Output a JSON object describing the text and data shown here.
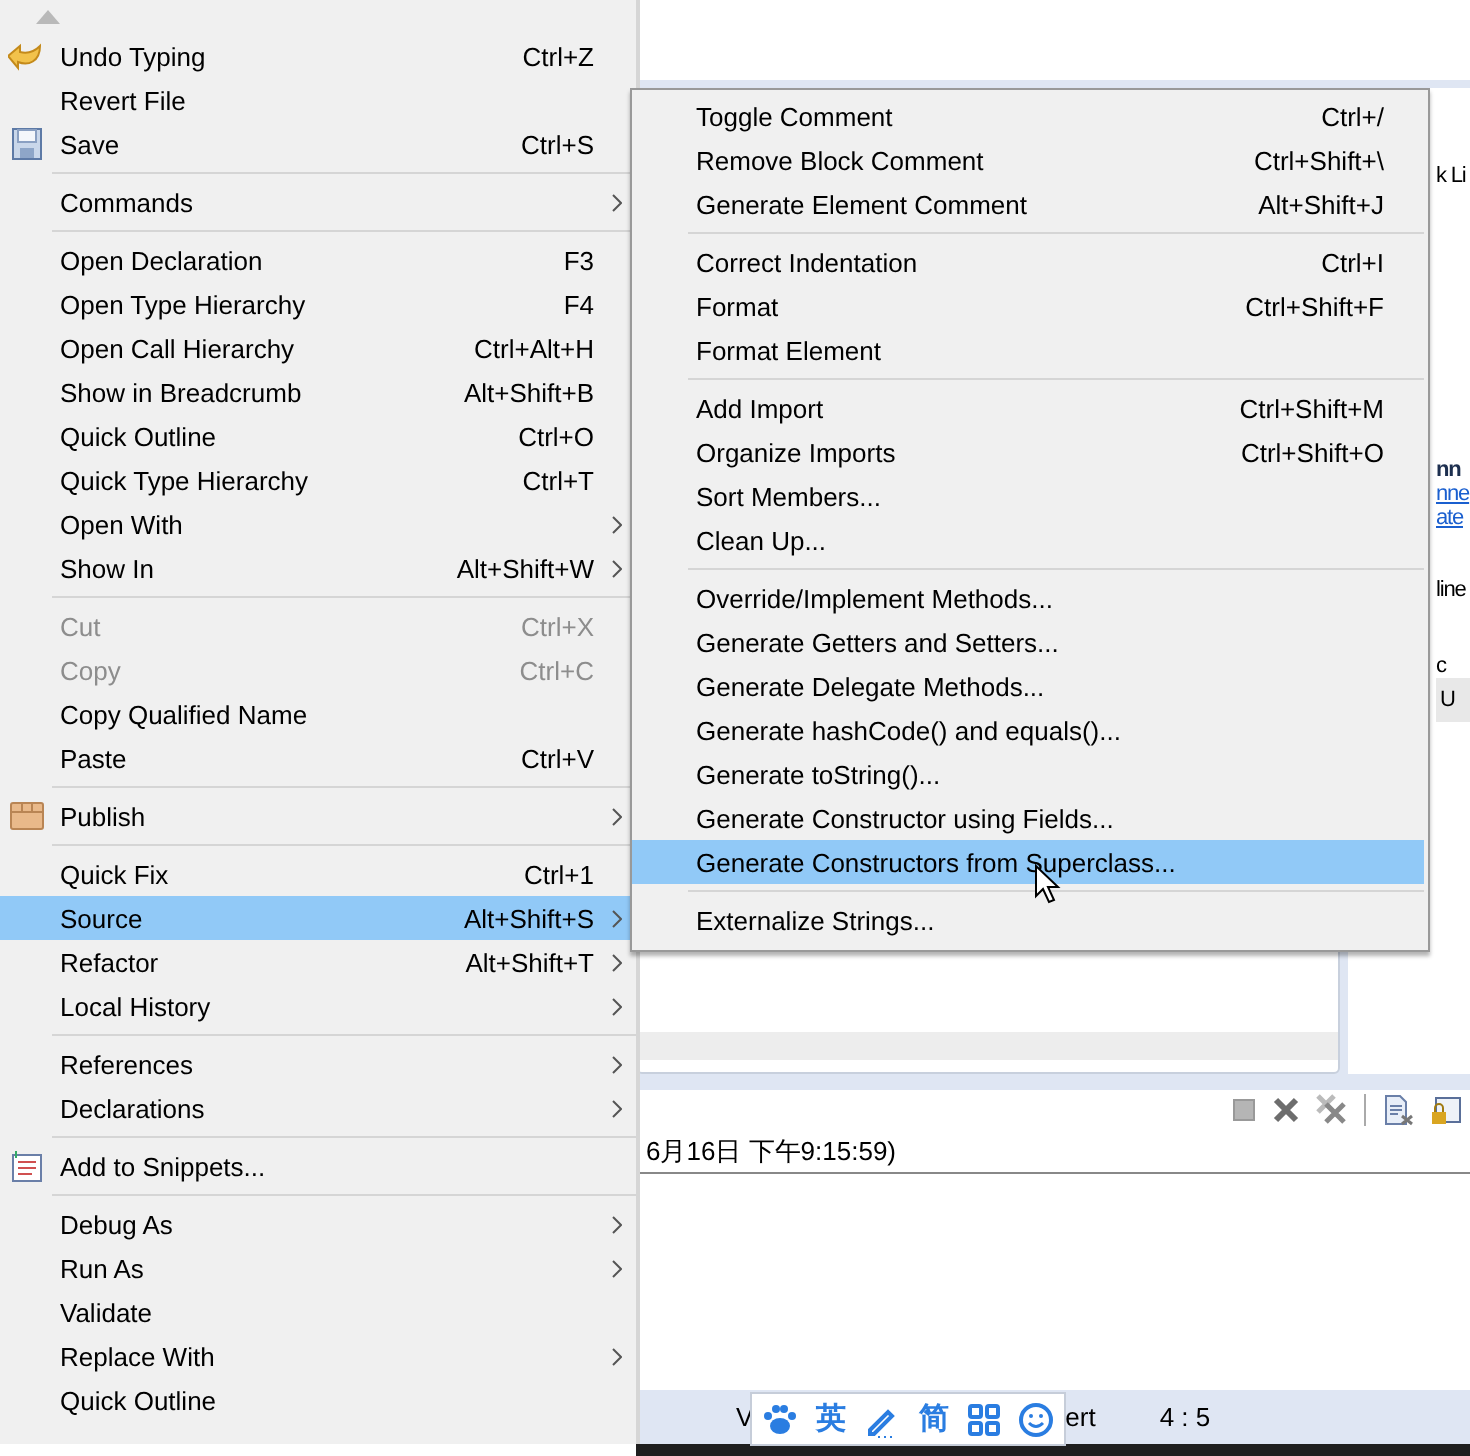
{
  "main_menu": {
    "items": [
      {
        "kind": "undo",
        "label": "Undo Typing",
        "shortcut": "Ctrl+Z",
        "submenu": false,
        "disabled": false,
        "selected": false
      },
      {
        "kind": "item",
        "label": "Revert File",
        "submenu": false,
        "disabled": false,
        "selected": false
      },
      {
        "kind": "save",
        "label": "Save",
        "shortcut": "Ctrl+S",
        "submenu": false,
        "disabled": false,
        "selected": false
      },
      {
        "kind": "separator"
      },
      {
        "kind": "item",
        "label": "Commands",
        "submenu": true,
        "disabled": false,
        "selected": false
      },
      {
        "kind": "separator"
      },
      {
        "kind": "item",
        "label": "Open Declaration",
        "shortcut": "F3",
        "submenu": false,
        "disabled": false,
        "selected": false
      },
      {
        "kind": "item",
        "label": "Open Type Hierarchy",
        "shortcut": "F4",
        "submenu": false,
        "disabled": false,
        "selected": false
      },
      {
        "kind": "item",
        "label": "Open Call Hierarchy",
        "shortcut": "Ctrl+Alt+H",
        "submenu": false,
        "disabled": false,
        "selected": false
      },
      {
        "kind": "item",
        "label": "Show in Breadcrumb",
        "shortcut": "Alt+Shift+B",
        "submenu": false,
        "disabled": false,
        "selected": false
      },
      {
        "kind": "item",
        "label": "Quick Outline",
        "shortcut": "Ctrl+O",
        "submenu": false,
        "disabled": false,
        "selected": false
      },
      {
        "kind": "item",
        "label": "Quick Type Hierarchy",
        "shortcut": "Ctrl+T",
        "submenu": false,
        "disabled": false,
        "selected": false
      },
      {
        "kind": "item",
        "label": "Open With",
        "submenu": true,
        "disabled": false,
        "selected": false
      },
      {
        "kind": "item",
        "label": "Show In",
        "shortcut": "Alt+Shift+W",
        "submenu": true,
        "disabled": false,
        "selected": false
      },
      {
        "kind": "separator"
      },
      {
        "kind": "item",
        "label": "Cut",
        "shortcut": "Ctrl+X",
        "submenu": false,
        "disabled": true,
        "selected": false
      },
      {
        "kind": "item",
        "label": "Copy",
        "shortcut": "Ctrl+C",
        "submenu": false,
        "disabled": true,
        "selected": false
      },
      {
        "kind": "item",
        "label": "Copy Qualified Name",
        "submenu": false,
        "disabled": false,
        "selected": false
      },
      {
        "kind": "item",
        "label": "Paste",
        "shortcut": "Ctrl+V",
        "submenu": false,
        "disabled": false,
        "selected": false
      },
      {
        "kind": "separator"
      },
      {
        "kind": "publish",
        "label": "Publish",
        "submenu": true,
        "disabled": false,
        "selected": false
      },
      {
        "kind": "separator"
      },
      {
        "kind": "item",
        "label": "Quick Fix",
        "shortcut": "Ctrl+1",
        "submenu": false,
        "disabled": false,
        "selected": false
      },
      {
        "kind": "item",
        "label": "Source",
        "shortcut": "Alt+Shift+S",
        "submenu": true,
        "disabled": false,
        "selected": true
      },
      {
        "kind": "item",
        "label": "Refactor",
        "shortcut": "Alt+Shift+T",
        "submenu": true,
        "disabled": false,
        "selected": false
      },
      {
        "kind": "item",
        "label": "Local History",
        "submenu": true,
        "disabled": false,
        "selected": false
      },
      {
        "kind": "separator"
      },
      {
        "kind": "item",
        "label": "References",
        "submenu": true,
        "disabled": false,
        "selected": false
      },
      {
        "kind": "item",
        "label": "Declarations",
        "submenu": true,
        "disabled": false,
        "selected": false
      },
      {
        "kind": "separator"
      },
      {
        "kind": "snippets",
        "label": "Add to Snippets...",
        "submenu": false,
        "disabled": false,
        "selected": false
      },
      {
        "kind": "separator"
      },
      {
        "kind": "item",
        "label": "Debug As",
        "submenu": true,
        "disabled": false,
        "selected": false
      },
      {
        "kind": "item",
        "label": "Run As",
        "submenu": true,
        "disabled": false,
        "selected": false
      },
      {
        "kind": "item",
        "label": "Validate",
        "submenu": false,
        "disabled": false,
        "selected": false
      },
      {
        "kind": "item",
        "label": "Replace With",
        "submenu": true,
        "disabled": false,
        "selected": false
      },
      {
        "kind": "item",
        "label": "Quick Outline",
        "submenu": false,
        "disabled": false,
        "selected": false
      }
    ]
  },
  "source_submenu": {
    "items": [
      {
        "kind": "item",
        "label": "Toggle Comment",
        "shortcut": "Ctrl+/",
        "selected": false
      },
      {
        "kind": "item",
        "label": "Remove Block Comment",
        "shortcut": "Ctrl+Shift+\\",
        "selected": false
      },
      {
        "kind": "item",
        "label": "Generate Element Comment",
        "shortcut": "Alt+Shift+J",
        "selected": false
      },
      {
        "kind": "separator"
      },
      {
        "kind": "item",
        "label": "Correct Indentation",
        "shortcut": "Ctrl+I",
        "selected": false
      },
      {
        "kind": "item",
        "label": "Format",
        "shortcut": "Ctrl+Shift+F",
        "selected": false
      },
      {
        "kind": "item",
        "label": "Format Element",
        "selected": false
      },
      {
        "kind": "separator"
      },
      {
        "kind": "item",
        "label": "Add Import",
        "shortcut": "Ctrl+Shift+M",
        "selected": false
      },
      {
        "kind": "item",
        "label": "Organize Imports",
        "shortcut": "Ctrl+Shift+O",
        "selected": false
      },
      {
        "kind": "item",
        "label": "Sort Members...",
        "selected": false
      },
      {
        "kind": "item",
        "label": "Clean Up...",
        "selected": false
      },
      {
        "kind": "separator"
      },
      {
        "kind": "item",
        "label": "Override/Implement Methods...",
        "selected": false
      },
      {
        "kind": "item",
        "label": "Generate Getters and Setters...",
        "selected": false
      },
      {
        "kind": "item",
        "label": "Generate Delegate Methods...",
        "selected": false
      },
      {
        "kind": "item",
        "label": "Generate hashCode() and equals()...",
        "selected": false
      },
      {
        "kind": "item",
        "label": "Generate toString()...",
        "selected": false
      },
      {
        "kind": "item",
        "label": "Generate Constructor using Fields...",
        "selected": false
      },
      {
        "kind": "item",
        "label": "Generate Constructors from Superclass...",
        "selected": true
      },
      {
        "kind": "separator"
      },
      {
        "kind": "item",
        "label": "Externalize Strings...",
        "selected": false
      }
    ]
  },
  "side_panel": {
    "fragments": [
      {
        "kind": "plain",
        "text": "k Li"
      },
      {
        "kind": "heading",
        "text": "nn"
      },
      {
        "kind": "link",
        "text": "nne"
      },
      {
        "kind": "link",
        "text": "ate"
      },
      {
        "kind": "plain",
        "text": "line"
      },
      {
        "kind": "plain",
        "text": "c"
      },
      {
        "kind": "row",
        "text": "U"
      }
    ]
  },
  "console": {
    "line": "6月16日 下午9:15:59)"
  },
  "status_bar": {
    "fields": [
      "V",
      "ert",
      "4 : 5"
    ]
  },
  "ime_toolbar": {
    "items": [
      {
        "kind": "paw"
      },
      {
        "kind": "text",
        "label": "英"
      },
      {
        "kind": "pencil"
      },
      {
        "kind": "text",
        "label": "简"
      },
      {
        "kind": "grid"
      },
      {
        "kind": "smiley"
      }
    ]
  }
}
